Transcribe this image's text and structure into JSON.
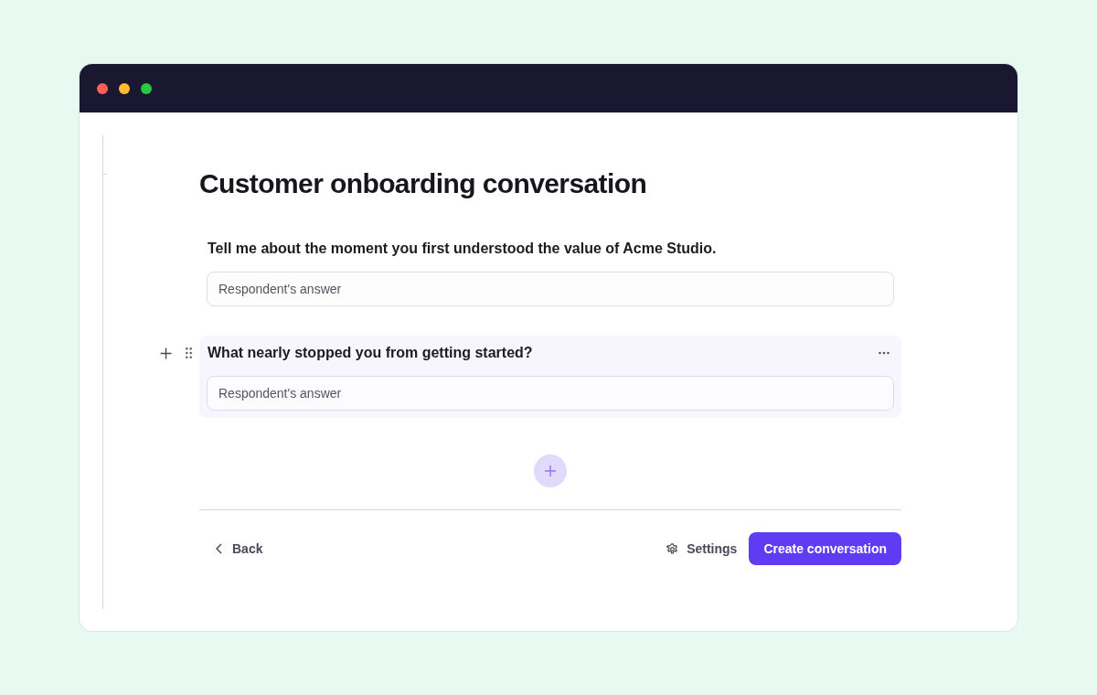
{
  "window": {
    "traffic_lights": [
      {
        "color": "#ff5f57"
      },
      {
        "color": "#febc2e"
      },
      {
        "color": "#28c840"
      }
    ]
  },
  "page": {
    "title": "Customer onboarding conversation"
  },
  "questions": [
    {
      "prompt": "Tell me about the moment you first understood the value of Acme Studio.",
      "answer_field": {
        "placeholder": "Respondent's answer"
      },
      "selected": false
    },
    {
      "prompt": "What nearly stopped you from getting started?",
      "answer_field": {
        "placeholder": "Respondent's answer"
      },
      "selected": true
    }
  ],
  "footer": {
    "back_button": "Back",
    "settings_button": "Settings",
    "create_button": "Create conversation"
  }
}
